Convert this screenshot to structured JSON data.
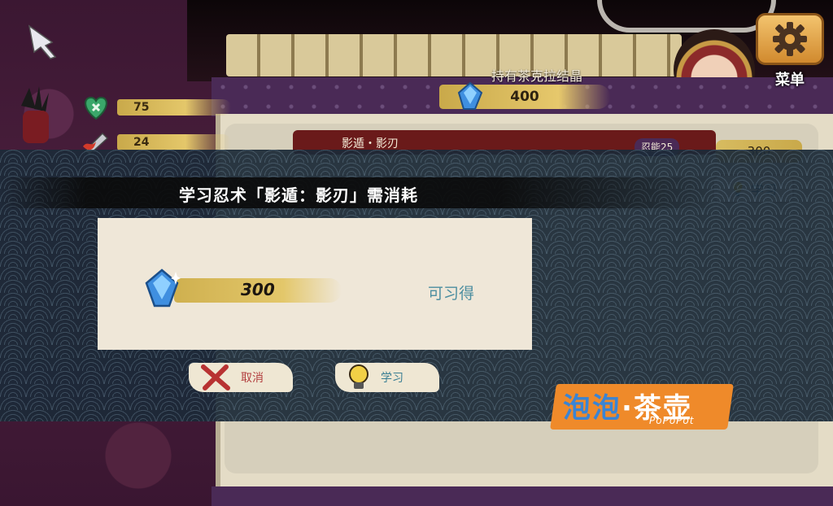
{
  "top_bar": {
    "crystal_label": "持有茶克拉结晶",
    "crystal_count": "400",
    "menu_label": "菜单"
  },
  "left_stats": [
    {
      "value": "75",
      "icon": "heart-heal-icon"
    },
    {
      "value": "24",
      "icon": "flame-weapon-icon"
    }
  ],
  "background_skill": {
    "name": "影遁・影刃",
    "level": "忍能25",
    "cost": "300",
    "learn_label": "学习"
  },
  "dialog": {
    "title": "学习忍术「影遁：影刃」需消耗",
    "cost_value": "300",
    "cost_icon": "blue-crystal-icon",
    "status": "可习得",
    "cancel_label": "取消",
    "learn_label": "学习"
  },
  "watermark": {
    "main_blue": "泡泡",
    "main_white": "·茶壶",
    "sub": "PoPoPot"
  },
  "colors": {
    "overlay": "#1c2a38",
    "gold_brush": "#e3c76a",
    "panel_cream": "#efe7d8",
    "status_teal": "#4c8ea0",
    "cancel_red": "#b34040",
    "menu_orange": "#d18a2e"
  }
}
